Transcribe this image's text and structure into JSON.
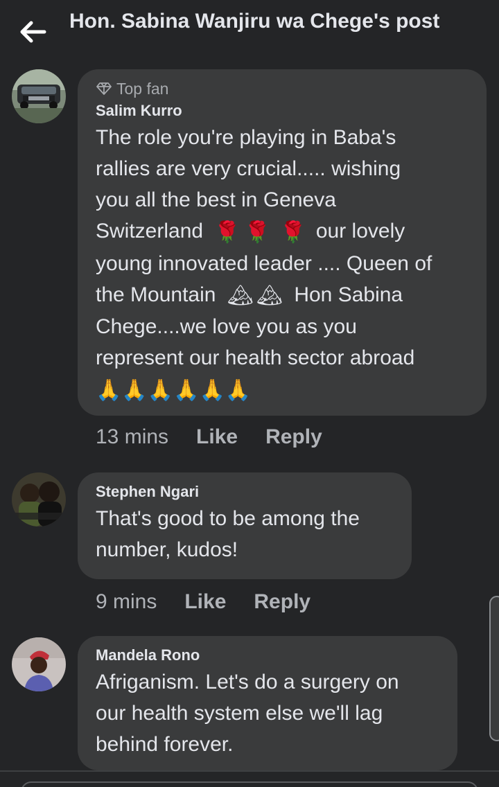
{
  "header": {
    "title": "Hon. Sabina Wanjiru wa Chege's post"
  },
  "colors": {
    "background": "#242527",
    "bubble": "#3a3b3c",
    "text": "#e4e6eb",
    "muted": "#b0b3b8",
    "badge": "#a8abaf"
  },
  "comments": [
    {
      "badge": "Top fan",
      "badge_icon": "diamond-icon",
      "author": "Salim Kurro",
      "lines": [
        "The role you're playing in Baba's",
        "rallies are very crucial..... wishing",
        "you all the best in Geneva",
        "Switzerland",
        "our lovely",
        "young innovated leader .... Queen of",
        "the Mountain",
        "Hon Sabina",
        "Chege....we love you as you",
        "represent our health sector abroad"
      ],
      "emojis": {
        "roses": "🌹",
        "mountain": "🏔",
        "pray": "🙏"
      },
      "time": "13 mins",
      "like": "Like",
      "reply": "Reply"
    },
    {
      "author": "Stephen Ngari",
      "lines": [
        "That's good to be among the",
        "number, kudos!"
      ],
      "time": "9 mins",
      "like": "Like",
      "reply": "Reply"
    },
    {
      "author": "Mandela Rono",
      "lines": [
        "Afriganism. Let's do a surgery on",
        "our health system else we'll lag",
        "behind forever."
      ]
    }
  ]
}
